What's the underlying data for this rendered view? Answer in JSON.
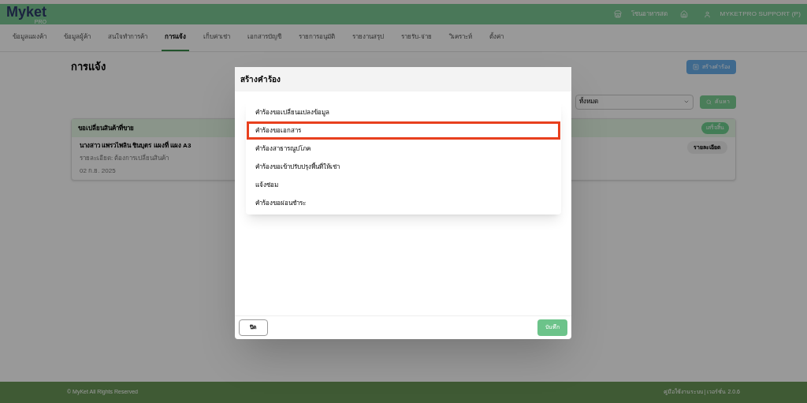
{
  "header": {
    "logo": "Myket",
    "logo_sub": "PRO",
    "store": "โซนอาหารสด",
    "user": "MYKETPRO SUPPORT (P)"
  },
  "nav": [
    {
      "label": "ข้อมูลแผงค้า",
      "selected": false
    },
    {
      "label": "ข้อมูลผู้ค้า",
      "selected": false
    },
    {
      "label": "สนใจทำการค้า",
      "selected": false
    },
    {
      "label": "การแจ้ง",
      "selected": true
    },
    {
      "label": "เก็บค่าเช่า",
      "selected": false
    },
    {
      "label": "เอกสารบัญชี",
      "selected": false
    },
    {
      "label": "รายการอนุมัติ",
      "selected": false
    },
    {
      "label": "รายงานสรุป",
      "selected": false
    },
    {
      "label": "รายรับ-จ่าย",
      "selected": false
    },
    {
      "label": "วิเคราะห์",
      "selected": false
    },
    {
      "label": "ตั้งค่า",
      "selected": false
    }
  ],
  "page": {
    "title": "การแจ้ง",
    "create_button": "สร้างคำร้อง",
    "filter": {
      "value": "ทั้งหมด"
    },
    "search_button": "ค้นหา"
  },
  "cards": [
    {
      "title": "ขอเปลี่ยนสินค้าที่ขาย",
      "status": "เสร็จสิ้น",
      "name": "นางสาว แพรวไพลิน ชินบุตร แผงที่ แผง A3",
      "detail": "รายละเอียด: ต้องการเปลี่ยนสินค้า",
      "date": "02 ก.ย. 2025",
      "detail_button": "รายละเอียด"
    }
  ],
  "modal": {
    "title": "สร้างคำร้อง",
    "options": [
      {
        "label": "คำร้องขอเปลี่ยนแปลงข้อมูล",
        "selected": false
      },
      {
        "label": "คำร้องขอเอกสาร",
        "selected": true
      },
      {
        "label": "คำร้องสาธารณูปโภค",
        "selected": false
      },
      {
        "label": "คำร้องขอเข้าปรับปรุงพื้นที่ให้เช่า",
        "selected": false
      },
      {
        "label": "แจ้งซ่อม",
        "selected": false
      },
      {
        "label": "คำร้องขอผ่อนชำระ",
        "selected": false
      }
    ],
    "close_button": "ปิด",
    "save_button": "บันทึก"
  },
  "footer": {
    "copyright": "© MyKet All Rights Reserved",
    "links": "คู่มือใช้งานระบบ | เวอร์ชั่น 2.0.6"
  }
}
